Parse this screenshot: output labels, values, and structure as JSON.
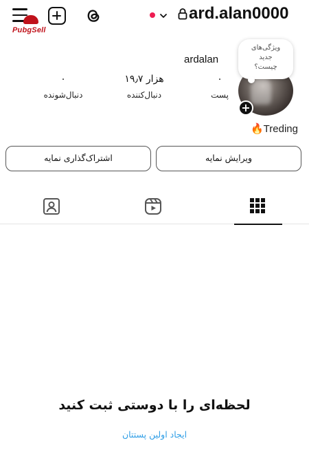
{
  "topbar": {
    "username": "ard.alan0000",
    "brand_watermark": "PubgSell",
    "icons": [
      "menu-icon",
      "plus-square-icon",
      "threads-icon",
      "chevron-down-icon",
      "lock-icon"
    ],
    "notification_dot_color": "#ee1d52"
  },
  "profile": {
    "display_name": "ardalan",
    "note": [
      "ویژگی‌های",
      "جدید",
      "چیست؟"
    ],
    "category": "🔥Treding",
    "add_story_symbol": "+"
  },
  "stats": {
    "posts": {
      "value": "۰",
      "label": "پست"
    },
    "followers": {
      "value": "۱۹٫۷ هزار",
      "label": "دنبال‌کننده"
    },
    "following": {
      "value": "۰",
      "label": "دنبال‌شونده"
    }
  },
  "buttons": {
    "edit": "ویرایش نمایه",
    "share": "اشتراک‌گذاری نمایه"
  },
  "tabs": {
    "active": "grid",
    "items": [
      "tagged-icon",
      "reels-icon",
      "grid-icon"
    ]
  },
  "empty_state": {
    "title": "لحظه‌ای را با دوستی ثبت کنید",
    "link": "ایجاد اولین پستتان"
  },
  "colors": {
    "accent_link": "#2f9ee6",
    "brand_red": "#c0121b"
  }
}
